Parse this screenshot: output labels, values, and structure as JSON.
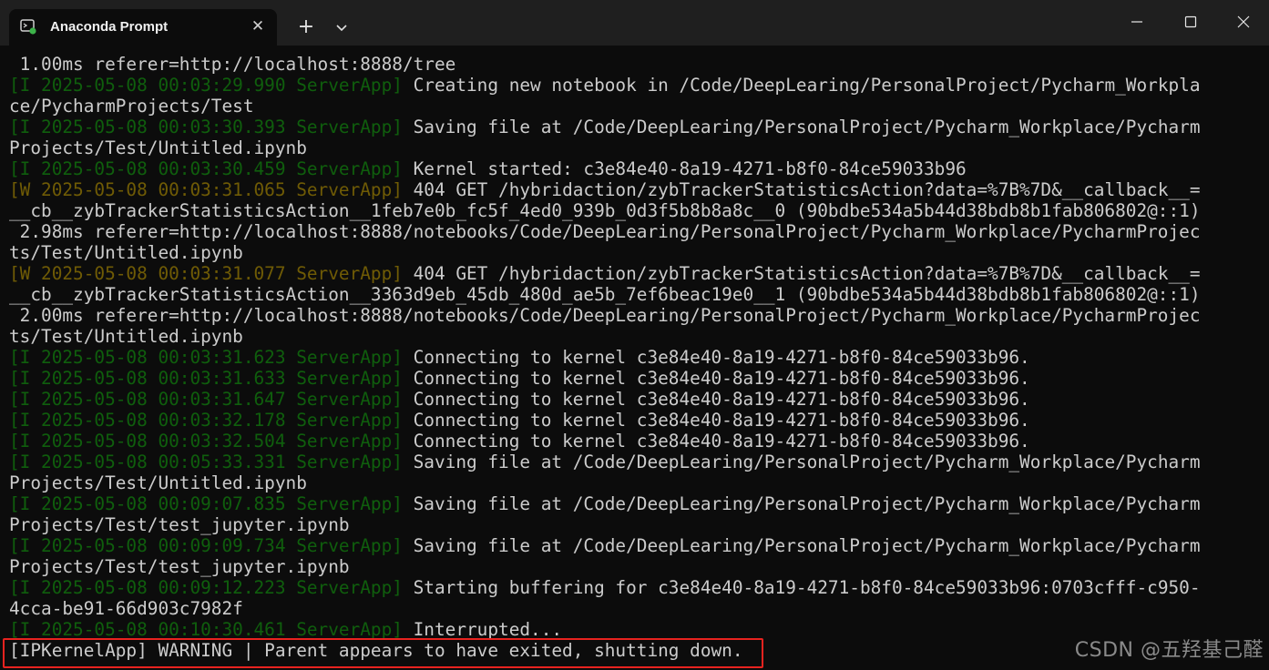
{
  "window": {
    "tab_title": "Anaconda Prompt",
    "tab_icon": "terminal-app-icon",
    "new_tab_icon": "plus-icon",
    "dropdown_icon": "chevron-down-icon",
    "minimize_icon": "minimize-icon",
    "maximize_icon": "maximize-icon",
    "close_icon": "close-icon"
  },
  "terminal": {
    "lines": [
      [
        {
          "t": " 1.00ms referer=http://localhost:8888/tree",
          "c": "normal"
        }
      ],
      [
        {
          "t": "[I 2025-05-08 00:03:29.990 ServerApp]",
          "c": "dim-green"
        },
        {
          "t": " Creating new notebook in /Code/DeepLearing/PersonalProject/Pycharm_Workpla",
          "c": "normal"
        }
      ],
      [
        {
          "t": "ce/PycharmProjects/Test",
          "c": "normal"
        }
      ],
      [
        {
          "t": "[I 2025-05-08 00:03:30.393 ServerApp]",
          "c": "dim-green"
        },
        {
          "t": " Saving file at /Code/DeepLearing/PersonalProject/Pycharm_Workplace/Pycharm",
          "c": "normal"
        }
      ],
      [
        {
          "t": "Projects/Test/Untitled.ipynb",
          "c": "normal"
        }
      ],
      [
        {
          "t": "[I 2025-05-08 00:03:30.459 ServerApp]",
          "c": "dim-green"
        },
        {
          "t": " Kernel started: c3e84e40-8a19-4271-b8f0-84ce59033b96",
          "c": "normal"
        }
      ],
      [
        {
          "t": "[W 2025-05-08 00:03:31.065 ServerApp]",
          "c": "dim-yellow"
        },
        {
          "t": " 404 GET /hybridaction/zybTrackerStatisticsAction?data=%7B%7D&__callback__=",
          "c": "normal"
        }
      ],
      [
        {
          "t": "__cb__zybTrackerStatisticsAction__1feb7e0b_fc5f_4ed0_939b_0d3f5b8b8a8c__0 (90bdbe534a5b44d38bdb8b1fab806802@::1)",
          "c": "normal"
        }
      ],
      [
        {
          "t": " 2.98ms referer=http://localhost:8888/notebooks/Code/DeepLearing/PersonalProject/Pycharm_Workplace/PycharmProjec",
          "c": "normal"
        }
      ],
      [
        {
          "t": "ts/Test/Untitled.ipynb",
          "c": "normal"
        }
      ],
      [
        {
          "t": "[W 2025-05-08 00:03:31.077 ServerApp]",
          "c": "dim-yellow"
        },
        {
          "t": " 404 GET /hybridaction/zybTrackerStatisticsAction?data=%7B%7D&__callback__=",
          "c": "normal"
        }
      ],
      [
        {
          "t": "__cb__zybTrackerStatisticsAction__3363d9eb_45db_480d_ae5b_7ef6beac19e0__1 (90bdbe534a5b44d38bdb8b1fab806802@::1)",
          "c": "normal"
        }
      ],
      [
        {
          "t": " 2.00ms referer=http://localhost:8888/notebooks/Code/DeepLearing/PersonalProject/Pycharm_Workplace/PycharmProjec",
          "c": "normal"
        }
      ],
      [
        {
          "t": "ts/Test/Untitled.ipynb",
          "c": "normal"
        }
      ],
      [
        {
          "t": "[I 2025-05-08 00:03:31.623 ServerApp]",
          "c": "dim-green"
        },
        {
          "t": " Connecting to kernel c3e84e40-8a19-4271-b8f0-84ce59033b96.",
          "c": "normal"
        }
      ],
      [
        {
          "t": "[I 2025-05-08 00:03:31.633 ServerApp]",
          "c": "dim-green"
        },
        {
          "t": " Connecting to kernel c3e84e40-8a19-4271-b8f0-84ce59033b96.",
          "c": "normal"
        }
      ],
      [
        {
          "t": "[I 2025-05-08 00:03:31.647 ServerApp]",
          "c": "dim-green"
        },
        {
          "t": " Connecting to kernel c3e84e40-8a19-4271-b8f0-84ce59033b96.",
          "c": "normal"
        }
      ],
      [
        {
          "t": "[I 2025-05-08 00:03:32.178 ServerApp]",
          "c": "dim-green"
        },
        {
          "t": " Connecting to kernel c3e84e40-8a19-4271-b8f0-84ce59033b96.",
          "c": "normal"
        }
      ],
      [
        {
          "t": "[I 2025-05-08 00:03:32.504 ServerApp]",
          "c": "dim-green"
        },
        {
          "t": " Connecting to kernel c3e84e40-8a19-4271-b8f0-84ce59033b96.",
          "c": "normal"
        }
      ],
      [
        {
          "t": "[I 2025-05-08 00:05:33.331 ServerApp]",
          "c": "dim-green"
        },
        {
          "t": " Saving file at /Code/DeepLearing/PersonalProject/Pycharm_Workplace/Pycharm",
          "c": "normal"
        }
      ],
      [
        {
          "t": "Projects/Test/Untitled.ipynb",
          "c": "normal"
        }
      ],
      [
        {
          "t": "[I 2025-05-08 00:09:07.835 ServerApp]",
          "c": "dim-green"
        },
        {
          "t": " Saving file at /Code/DeepLearing/PersonalProject/Pycharm_Workplace/Pycharm",
          "c": "normal"
        }
      ],
      [
        {
          "t": "Projects/Test/test_jupyter.ipynb",
          "c": "normal"
        }
      ],
      [
        {
          "t": "[I 2025-05-08 00:09:09.734 ServerApp]",
          "c": "dim-green"
        },
        {
          "t": " Saving file at /Code/DeepLearing/PersonalProject/Pycharm_Workplace/Pycharm",
          "c": "normal"
        }
      ],
      [
        {
          "t": "Projects/Test/test_jupyter.ipynb",
          "c": "normal"
        }
      ],
      [
        {
          "t": "[I 2025-05-08 00:09:12.223 ServerApp]",
          "c": "dim-green"
        },
        {
          "t": " Starting buffering for c3e84e40-8a19-4271-b8f0-84ce59033b96:0703cfff-c950-",
          "c": "normal"
        }
      ],
      [
        {
          "t": "4cca-be91-66d903c7982f",
          "c": "normal"
        }
      ],
      [
        {
          "t": "[I 2025-05-08 00:10:30.461 ServerApp]",
          "c": "dim-green"
        },
        {
          "t": " Interrupted...",
          "c": "normal"
        }
      ],
      [
        {
          "t": "[IPKernelApp] WARNING | Parent appears to have exited, shutting down.",
          "c": "normal"
        }
      ]
    ]
  },
  "watermark": "CSDN @五羟基己醛",
  "colors": {
    "background": "#0c0c0c",
    "titlebar": "#1f1f1f",
    "text": "#cccccc",
    "info_prefix": "#13a10e",
    "warning_prefix": "#c19c00",
    "highlight_border": "#e8231f"
  }
}
